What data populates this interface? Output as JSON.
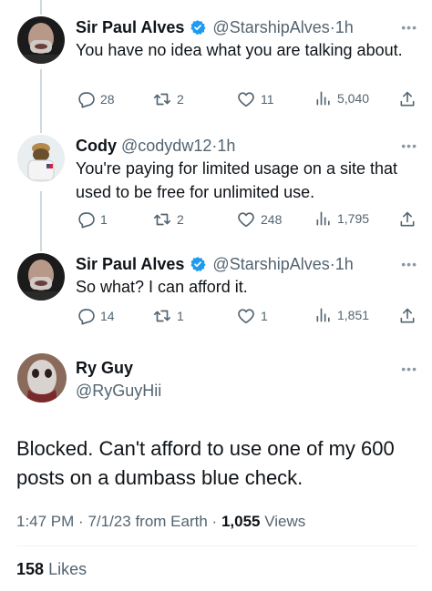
{
  "colors": {
    "text": "#0f1419",
    "secondary": "#536471",
    "verified": "#1d9bf0",
    "line": "#cfd9de"
  },
  "replies": [
    {
      "name": "Sir Paul Alves",
      "verified": true,
      "handle": "@StarshipAlves",
      "dot": "·",
      "time": "1h",
      "text": "You have no idea what you are talking about.",
      "stats": {
        "replies": "28",
        "reposts": "2",
        "likes": "11",
        "views": "5,040"
      }
    },
    {
      "name": "Cody",
      "verified": false,
      "handle": "@codydw12",
      "dot": "·",
      "time": "1h",
      "text": "You're paying for limited usage on a site that used to be free for unlimited use.",
      "stats": {
        "replies": "1",
        "reposts": "2",
        "likes": "248",
        "views": "1,795"
      }
    },
    {
      "name": "Sir Paul Alves",
      "verified": true,
      "handle": "@StarshipAlves",
      "dot": "·",
      "time": "1h",
      "text": "So what? I can afford it.",
      "stats": {
        "replies": "14",
        "reposts": "1",
        "likes": "1",
        "views": "1,851"
      }
    }
  ],
  "main": {
    "name": "Ry Guy",
    "handle": "@RyGuyHii",
    "text": "Blocked. Can't afford to use one of my 600 posts on a dumbass blue check.",
    "time": "1:47 PM",
    "date": "7/1/23",
    "source": "from Earth",
    "sep": "·",
    "views_count": "1,055",
    "views_label": "Views",
    "likes_count": "158",
    "likes_label": "Likes"
  },
  "icons": [
    "reply-icon",
    "repost-icon",
    "like-icon",
    "views-icon",
    "share-icon",
    "more-icon",
    "verified-badge-icon"
  ]
}
